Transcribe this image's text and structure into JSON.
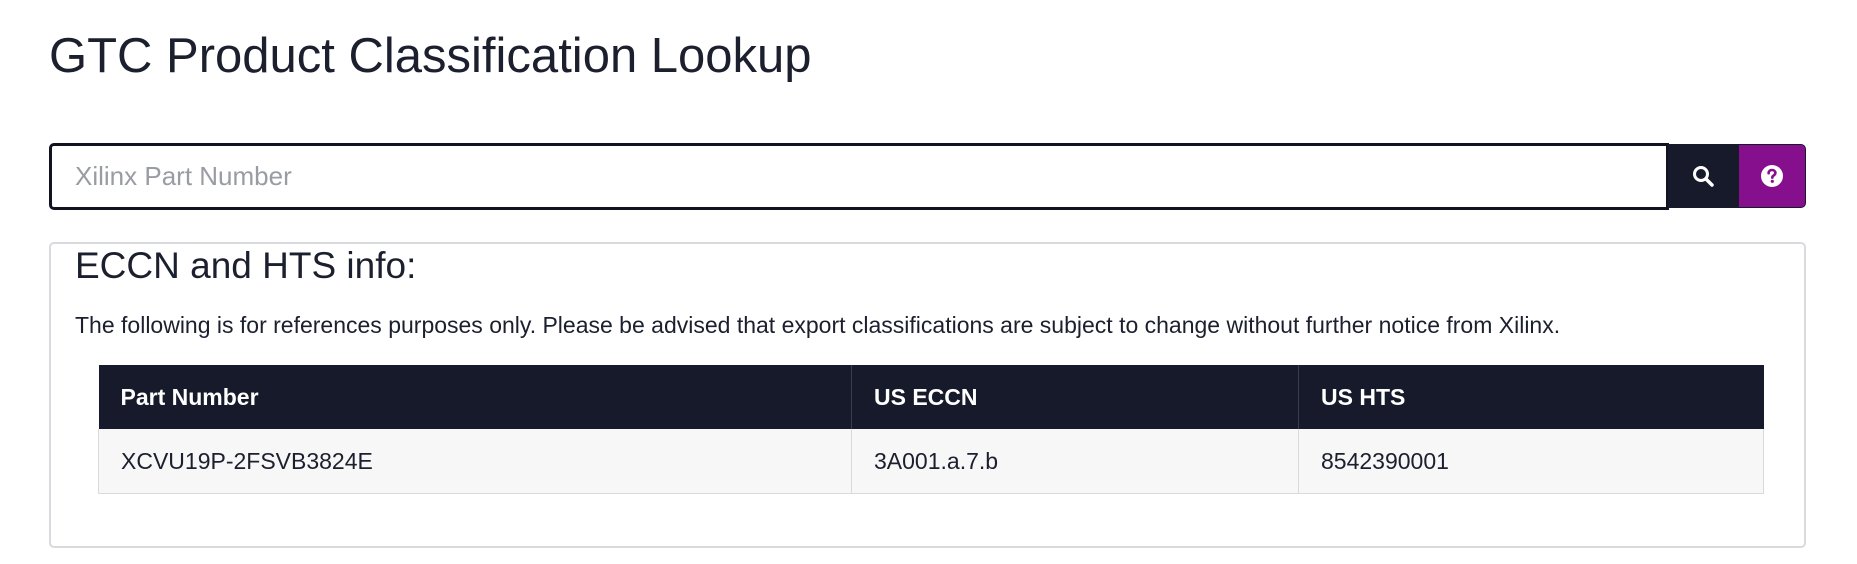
{
  "page": {
    "title": "GTC Product Classification Lookup"
  },
  "search": {
    "placeholder": "Xilinx Part Number",
    "value": "",
    "search_icon": "search-icon",
    "help_icon": "question-circle-icon"
  },
  "colors": {
    "dark": "#171a2a",
    "accent": "#860f8e",
    "row_bg": "#f7f7f7",
    "border": "#d9dadd"
  },
  "info": {
    "heading": "ECCN and HTS info:",
    "notice": "The following is for references purposes only. Please be advised that export classifications are subject to change without further notice from Xilinx.",
    "table": {
      "headers": [
        "Part Number",
        "US ECCN",
        "US HTS"
      ],
      "rows": [
        [
          "XCVU19P-2FSVB3824E",
          "3A001.a.7.b",
          "8542390001"
        ]
      ]
    }
  }
}
